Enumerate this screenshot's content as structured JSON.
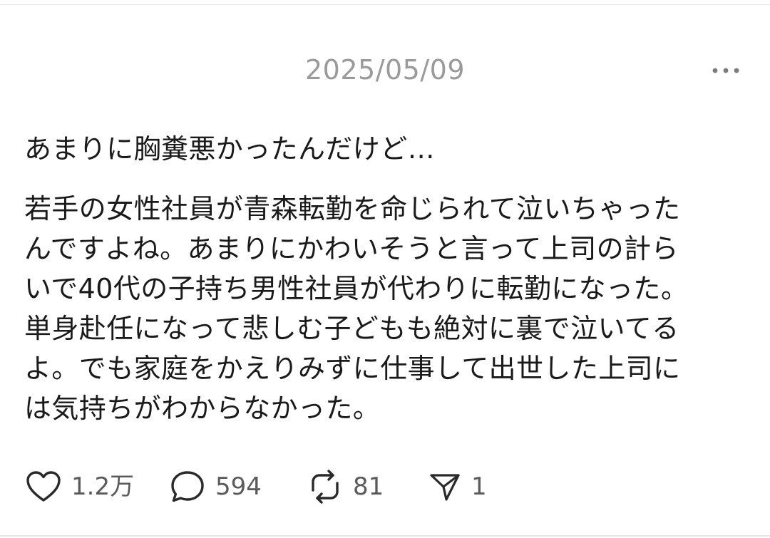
{
  "header": {
    "date": "2025/05/09",
    "more_icon": "more-horizontal-icon"
  },
  "post": {
    "title": "あまりに胸糞悪かったんだけど…",
    "body_lines": [
      "若手の女性社員が青森転勤を命じられて泣いちゃった",
      "んですよね。あまりにかわいそうと言って上司の計ら",
      "いで40代の子持ち男性社員が代わりに転勤になった。",
      "単身赴任になって悲しむ子どもも絶対に裏で泣いてる",
      "よ。でも家庭をかえりみずに仕事して出世した上司に",
      "は気持ちがわからなかった。"
    ]
  },
  "actions": {
    "like": {
      "icon": "heart-icon",
      "count": "1.2万"
    },
    "reply": {
      "icon": "speech-bubble-icon",
      "count": "594"
    },
    "repost": {
      "icon": "repost-icon",
      "count": "81"
    },
    "share": {
      "icon": "send-icon",
      "count": "1"
    }
  },
  "colors": {
    "text": "#1a1a1a",
    "muted": "#9a9a9a",
    "icon": "#2a2a2a",
    "divider": "#e6e6e6"
  }
}
